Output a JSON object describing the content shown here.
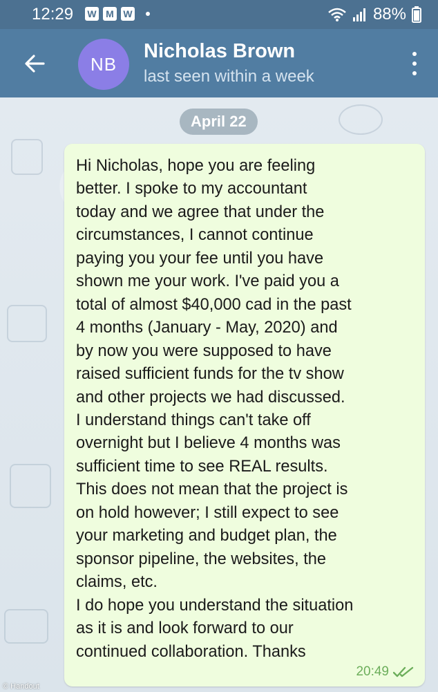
{
  "status_bar": {
    "time": "12:29",
    "notifications": [
      "W",
      "M",
      "W"
    ],
    "battery": "88%"
  },
  "header": {
    "avatar_initials": "NB",
    "contact_name": "Nicholas Brown",
    "last_seen": "last seen within a week"
  },
  "chat": {
    "date_label": "April 22",
    "message": {
      "text": "Hi Nicholas, hope you are feeling\nbetter. I spoke to my accountant\ntoday and we agree that under the\ncircumstances, I cannot continue\npaying you your fee until you have\nshown me your work. I've paid you a\ntotal of almost $40,000 cad in the past\n4 months (January - May, 2020) and\nby now you were supposed to have\nraised sufficient funds for the tv show\nand other projects we had discussed.\nI understand things can't take off\novernight but I believe 4 months was\nsufficient time to see REAL results.\nThis does not mean that the project is\non hold however; I still expect to see\nyour marketing and budget plan, the\nsponsor pipeline, the websites, the\nclaims, etc.\nI do hope you understand the situation\nas it is and look forward to our\ncontinued collaboration. Thanks",
      "time": "20:49"
    }
  },
  "credit": "© Handout",
  "colors": {
    "status_bar": "#4c7191",
    "header": "#517da2",
    "avatar": "#8b7ee6",
    "bubble": "#effdde",
    "read_check": "#6cae5b"
  }
}
